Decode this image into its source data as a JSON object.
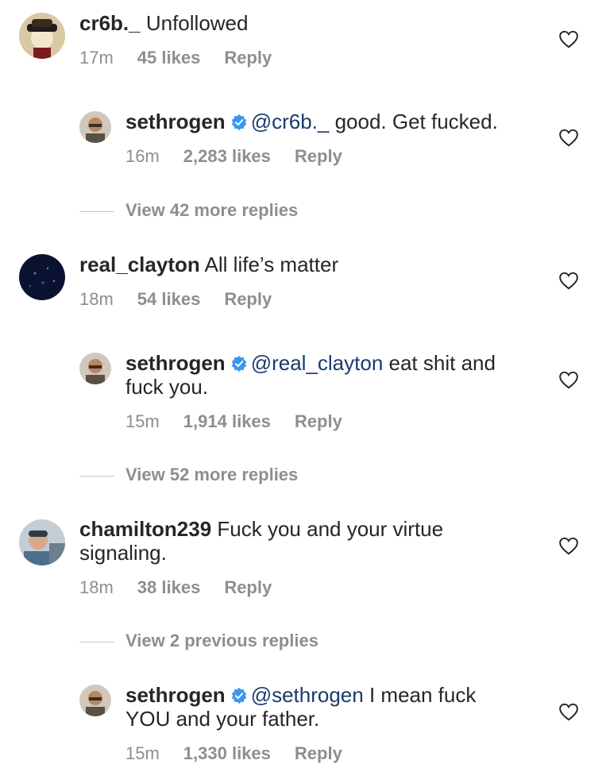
{
  "comments": [
    {
      "username": "cr6b._",
      "text": "Unfollowed",
      "time": "17m",
      "likes": "45 likes",
      "reply": "Reply"
    },
    {
      "username": "sethrogen",
      "mention": "@cr6b._",
      "text": "good. Get fucked.",
      "time": "16m",
      "likes": "2,283 likes",
      "reply": "Reply"
    },
    {
      "username": "real_clayton",
      "text": "All life’s matter",
      "time": "18m",
      "likes": "54 likes",
      "reply": "Reply"
    },
    {
      "username": "sethrogen",
      "mention": "@real_clayton",
      "text": "eat shit and fuck you.",
      "time": "15m",
      "likes": "1,914 likes",
      "reply": "Reply"
    },
    {
      "username": "chamilton239",
      "text": "Fuck you and your virtue signaling.",
      "time": "18m",
      "likes": "38 likes",
      "reply": "Reply"
    },
    {
      "username": "sethrogen",
      "mention": "@sethrogen",
      "text": "I mean fuck YOU and your father.",
      "time": "15m",
      "likes": "1,330 likes",
      "reply": "Reply"
    }
  ],
  "view_more": [
    "View 42 more replies",
    "View 52 more replies",
    "View 2 previous replies"
  ],
  "colors": {
    "verified": "#3897f0",
    "mention": "#1c3a6e",
    "meta": "#8e8e8e"
  },
  "icons": {
    "like": "heart-outline-icon",
    "verified": "verified-badge-icon"
  }
}
